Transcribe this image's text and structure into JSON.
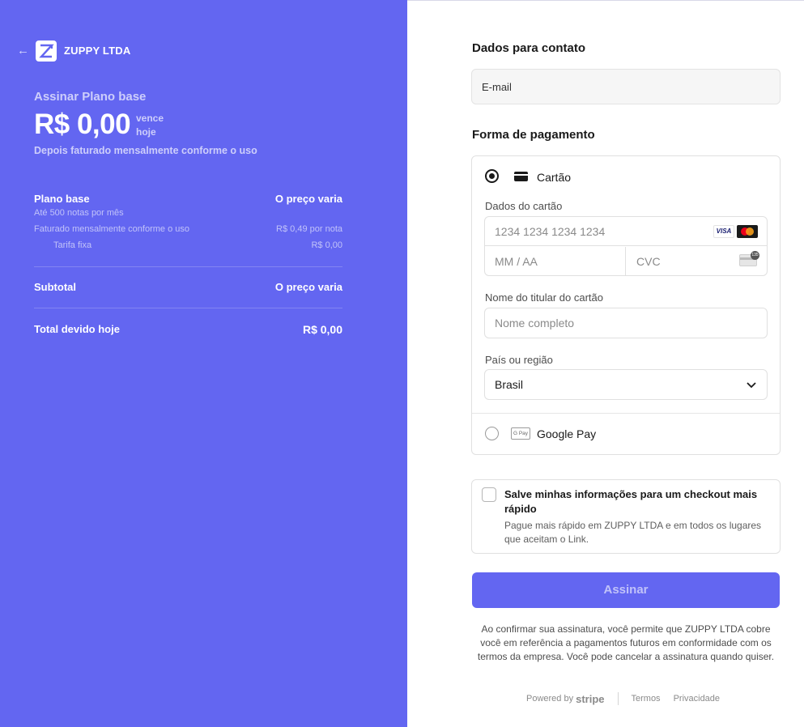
{
  "left": {
    "brand": "ZUPPY LTDA",
    "plan_title": "Assinar Plano base",
    "price": "R$ 0,00",
    "due_line1": "vence",
    "due_line2": "hoje",
    "billing_note": "Depois faturado mensalmente conforme o uso",
    "item": {
      "name": "Plano base",
      "price": "O preço varia",
      "note": "Até 500 notas por mês",
      "billing": "Faturado mensalmente conforme o uso",
      "unit_price": "R$ 0,49 por nota",
      "fee_label": "Tarifa fixa",
      "fee_value": "R$ 0,00"
    },
    "subtotal_label": "Subtotal",
    "subtotal_value": "O preço varia",
    "total_label": "Total devido hoje",
    "total_value": "R$ 0,00"
  },
  "contact": {
    "title": "Dados para contato",
    "email_placeholder": "E-mail"
  },
  "payment": {
    "title": "Forma de pagamento",
    "card_option": "Cartão",
    "card_details_label": "Dados do cartão",
    "card_number_placeholder": "1234 1234 1234 1234",
    "visa_label": "VISA",
    "expiry_placeholder": "MM / AA",
    "cvc_placeholder": "CVC",
    "holder_label": "Nome do titular do cartão",
    "holder_placeholder": "Nome completo",
    "country_label": "País ou região",
    "country_value": "Brasil",
    "gpay_icon_text": "G Pay",
    "gpay_option": "Google Pay"
  },
  "save": {
    "title": "Salve minhas informações para um checkout mais rápido",
    "description": "Pague mais rápido em ZUPPY LTDA e em todos os lugares que aceitam o Link."
  },
  "subscribe_label": "Assinar",
  "legal_text": "Ao confirmar sua assinatura, você permite que ZUPPY LTDA cobre você em referência a pagamentos futuros em conformidade com os termos da empresa. Você pode cancelar a assinatura quando quiser.",
  "footer": {
    "powered_by": "Powered by",
    "stripe": "stripe",
    "terms": "Termos",
    "privacy": "Privacidade"
  },
  "colors": {
    "accent": "#6366f1"
  }
}
